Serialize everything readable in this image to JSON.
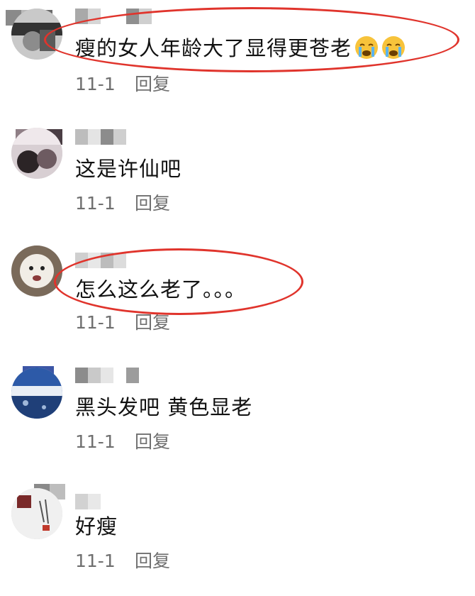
{
  "comments": [
    {
      "text": "瘦的女人年龄大了显得更苍老",
      "emoji": [
        "crying-face",
        "crying-face"
      ],
      "date": "11-1",
      "reply": "回复",
      "highlighted": true
    },
    {
      "text": "这是许仙吧",
      "date": "11-1",
      "reply": "回复",
      "highlighted": false
    },
    {
      "text": "怎么这么老了。。。",
      "date": "11-1",
      "reply": "回复",
      "highlighted": true
    },
    {
      "text": "黑头发吧 黄色显老",
      "date": "11-1",
      "reply": "回复",
      "highlighted": false
    },
    {
      "text": "好瘦",
      "date": "11-1",
      "reply": "回复",
      "highlighted": false
    }
  ],
  "colors": {
    "highlight_ring": "#e0342c",
    "meta_text": "#6f6f6f",
    "body_text": "#111111"
  }
}
